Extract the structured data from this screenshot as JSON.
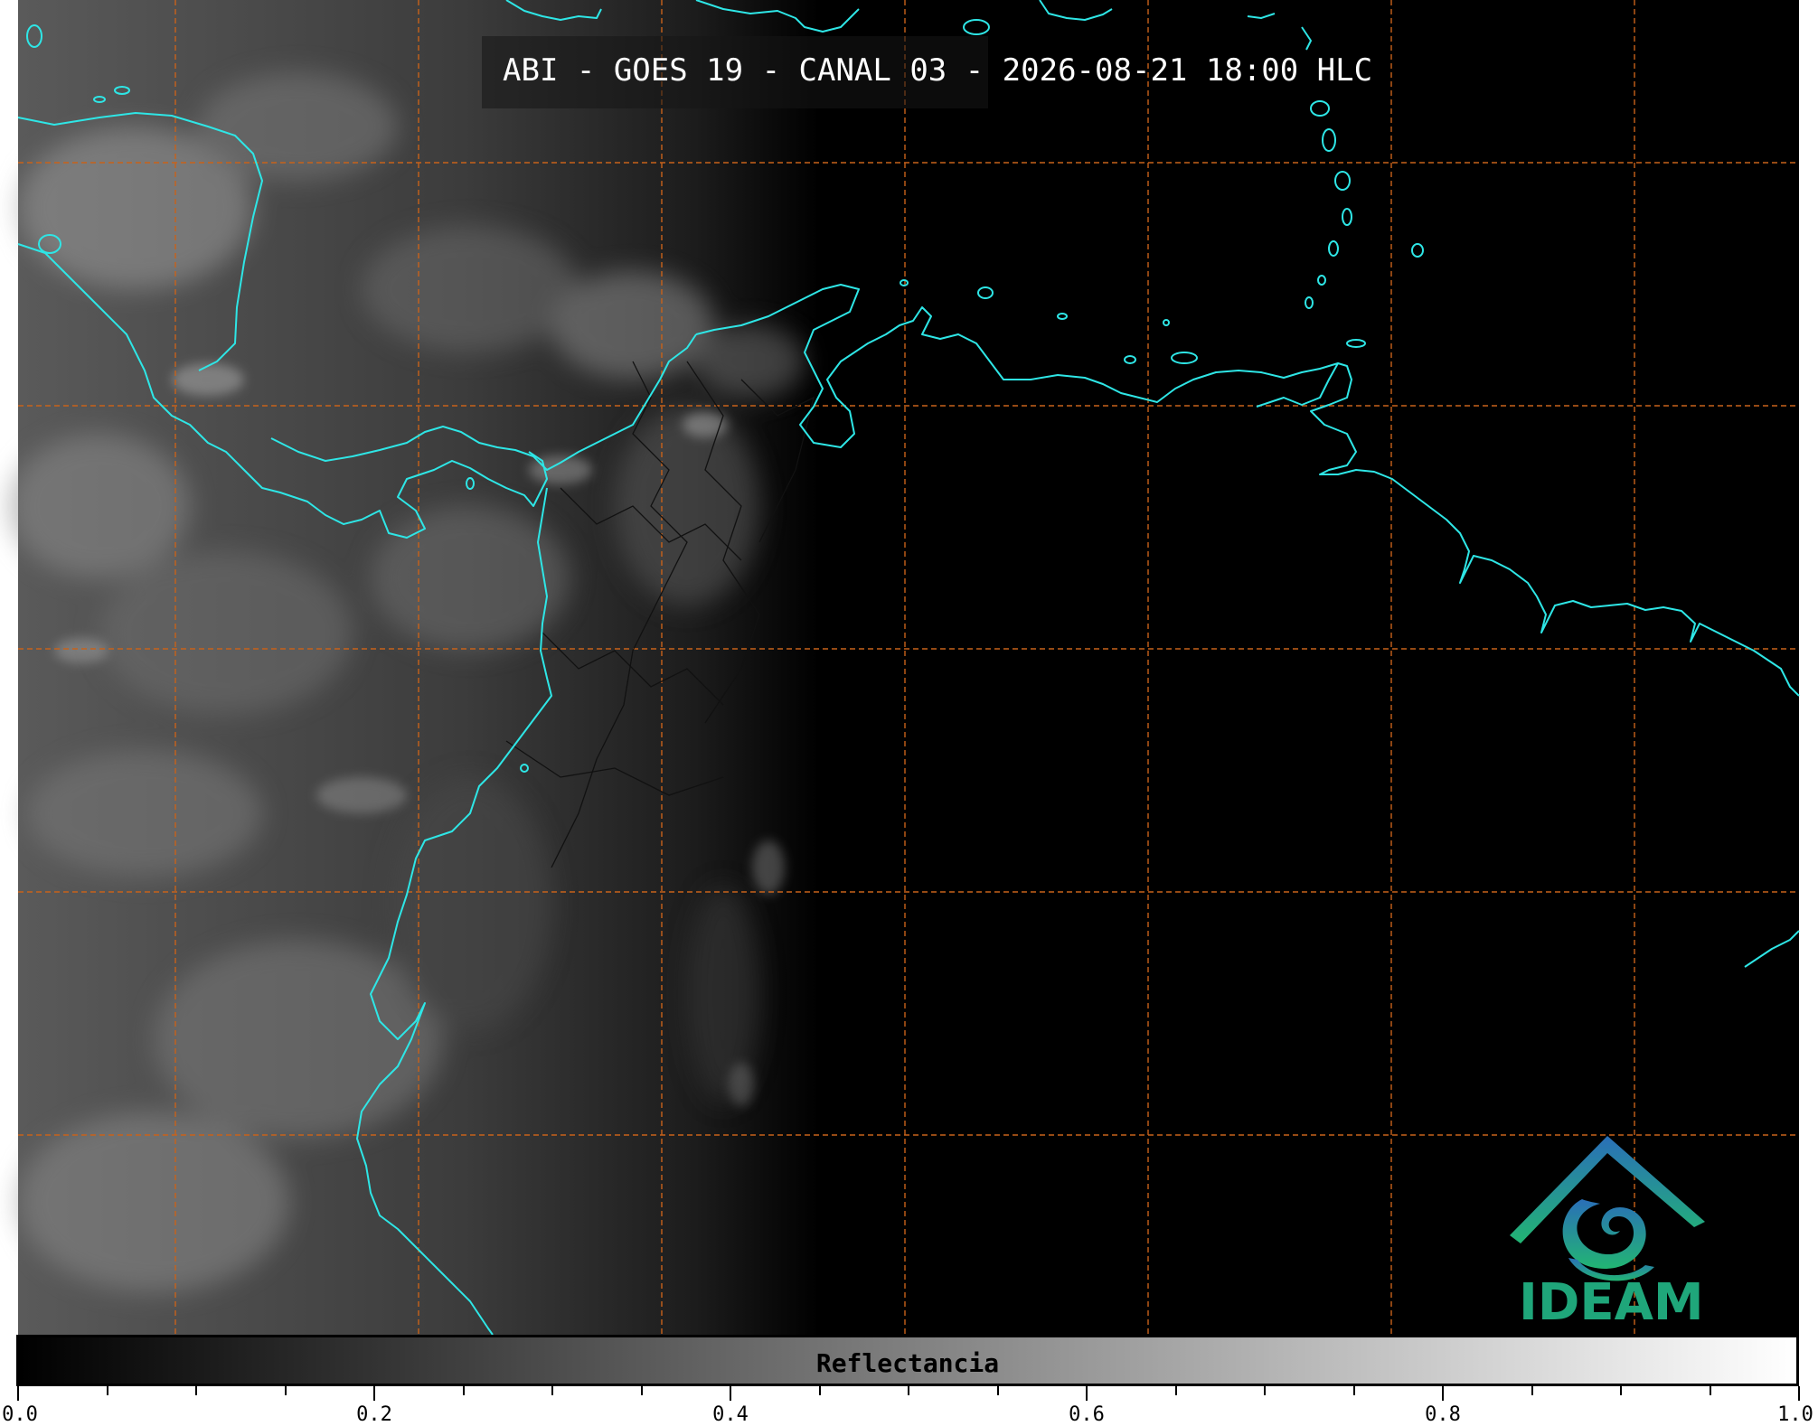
{
  "title": "ABI - GOES 19 - CANAL 03 - 2026-08-21 18:00 HLC",
  "colors": {
    "coastline": "#2ee6e6",
    "gridlines": "#c8621a",
    "borders": "#111111",
    "logo_gradient_top": "#2a6fb8",
    "logo_gradient_bottom": "#22b573"
  },
  "logo": {
    "text": "IDEAM",
    "icon": "ideam-mountain-swirl-logo"
  },
  "colorbar": {
    "label": "Reflectancia",
    "range": [
      0.0,
      1.0
    ],
    "tick_labels": [
      "0.0",
      "0.2",
      "0.4",
      "0.6",
      "0.8",
      "1.0"
    ],
    "colormap": "grayscale black-to-white"
  }
}
